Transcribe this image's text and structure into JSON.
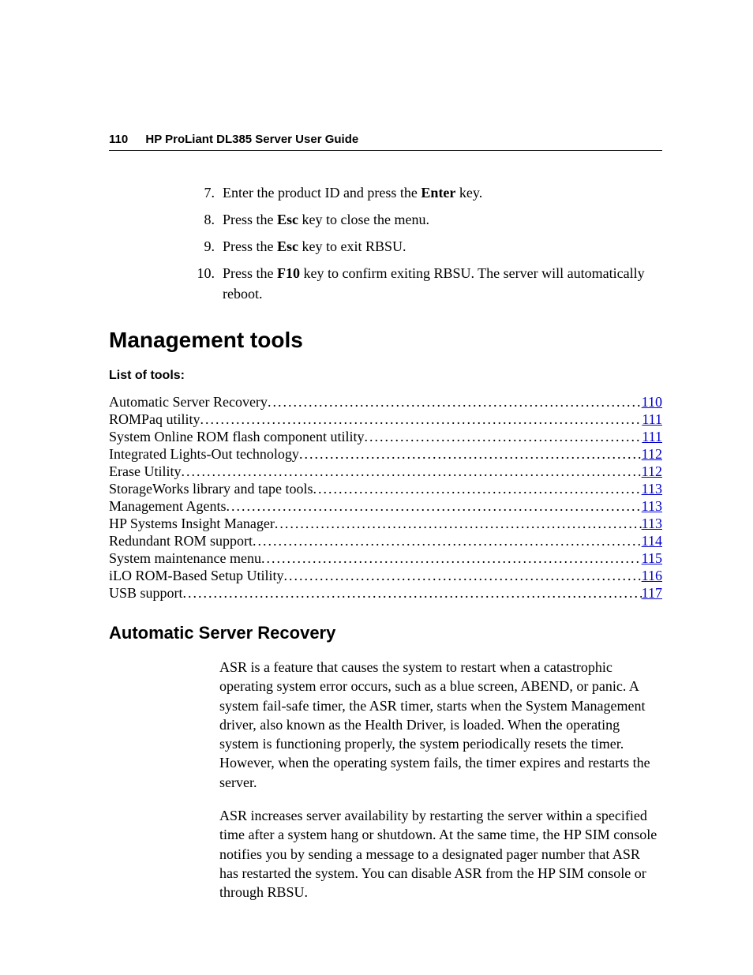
{
  "header": {
    "page_number": "110",
    "title": "HP ProLiant DL385 Server User Guide"
  },
  "steps": [
    {
      "n": "7.",
      "pre": "Enter the product ID and press the ",
      "bold": "Enter",
      "post": " key."
    },
    {
      "n": "8.",
      "pre": "Press the ",
      "bold": "Esc",
      "post": " key to close the menu."
    },
    {
      "n": "9.",
      "pre": "Press the ",
      "bold": "Esc",
      "post": " key to exit RBSU."
    },
    {
      "n": "10.",
      "pre": "Press the ",
      "bold": "F10",
      "post": " key to confirm exiting RBSU. The server will automatically reboot."
    }
  ],
  "section_heading": "Management tools",
  "list_of_tools_label": "List of tools:",
  "toc": [
    {
      "label": "Automatic Server Recovery",
      "page": "110"
    },
    {
      "label": "ROMPaq utility ",
      "page": "111"
    },
    {
      "label": "System Online ROM flash component utility ",
      "page": "111"
    },
    {
      "label": "Integrated Lights-Out technology",
      "page": "112"
    },
    {
      "label": "Erase Utility",
      "page": "112"
    },
    {
      "label": "StorageWorks library and tape tools",
      "page": "113"
    },
    {
      "label": "Management Agents",
      "page": "113"
    },
    {
      "label": "HP Systems Insight Manager ",
      "page": "113"
    },
    {
      "label": "Redundant ROM support",
      "page": "114"
    },
    {
      "label": "System maintenance menu ",
      "page": "115"
    },
    {
      "label": "iLO ROM-Based Setup Utility",
      "page": "116"
    },
    {
      "label": "USB support ",
      "page": "117"
    }
  ],
  "subsection_heading": "Automatic Server Recovery",
  "paragraphs": [
    "ASR is a feature that causes the system to restart when a catastrophic operating system error occurs, such as a blue screen, ABEND, or panic. A system fail-safe timer, the ASR timer, starts when the System Management driver, also known as the Health Driver, is loaded. When the operating system is functioning properly, the system periodically resets the timer. However, when the operating system fails, the timer expires and restarts the server.",
    "ASR increases server availability by restarting the server within a specified time after a system hang or shutdown. At the same time, the HP SIM console notifies you by sending a message to a designated pager number that ASR has restarted the system. You can disable ASR from the HP SIM console or through RBSU."
  ]
}
